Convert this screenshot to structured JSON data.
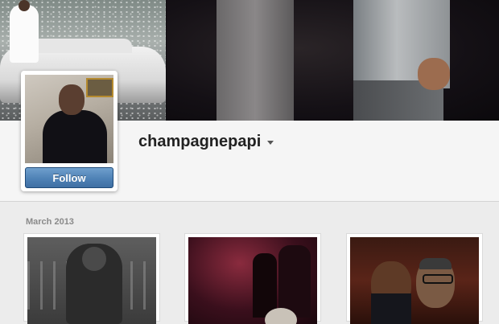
{
  "profile": {
    "username": "champagnepapi",
    "follow_label": "Follow"
  },
  "feed": {
    "section_label": "March 2013"
  },
  "icons": {
    "username_dropdown": "chevron-down-icon"
  },
  "colors": {
    "follow_button": "#4f82b6",
    "band_background": "#f5f5f5",
    "page_background": "#ececec",
    "username_text": "#222222",
    "section_label_text": "#8a8a8a"
  }
}
